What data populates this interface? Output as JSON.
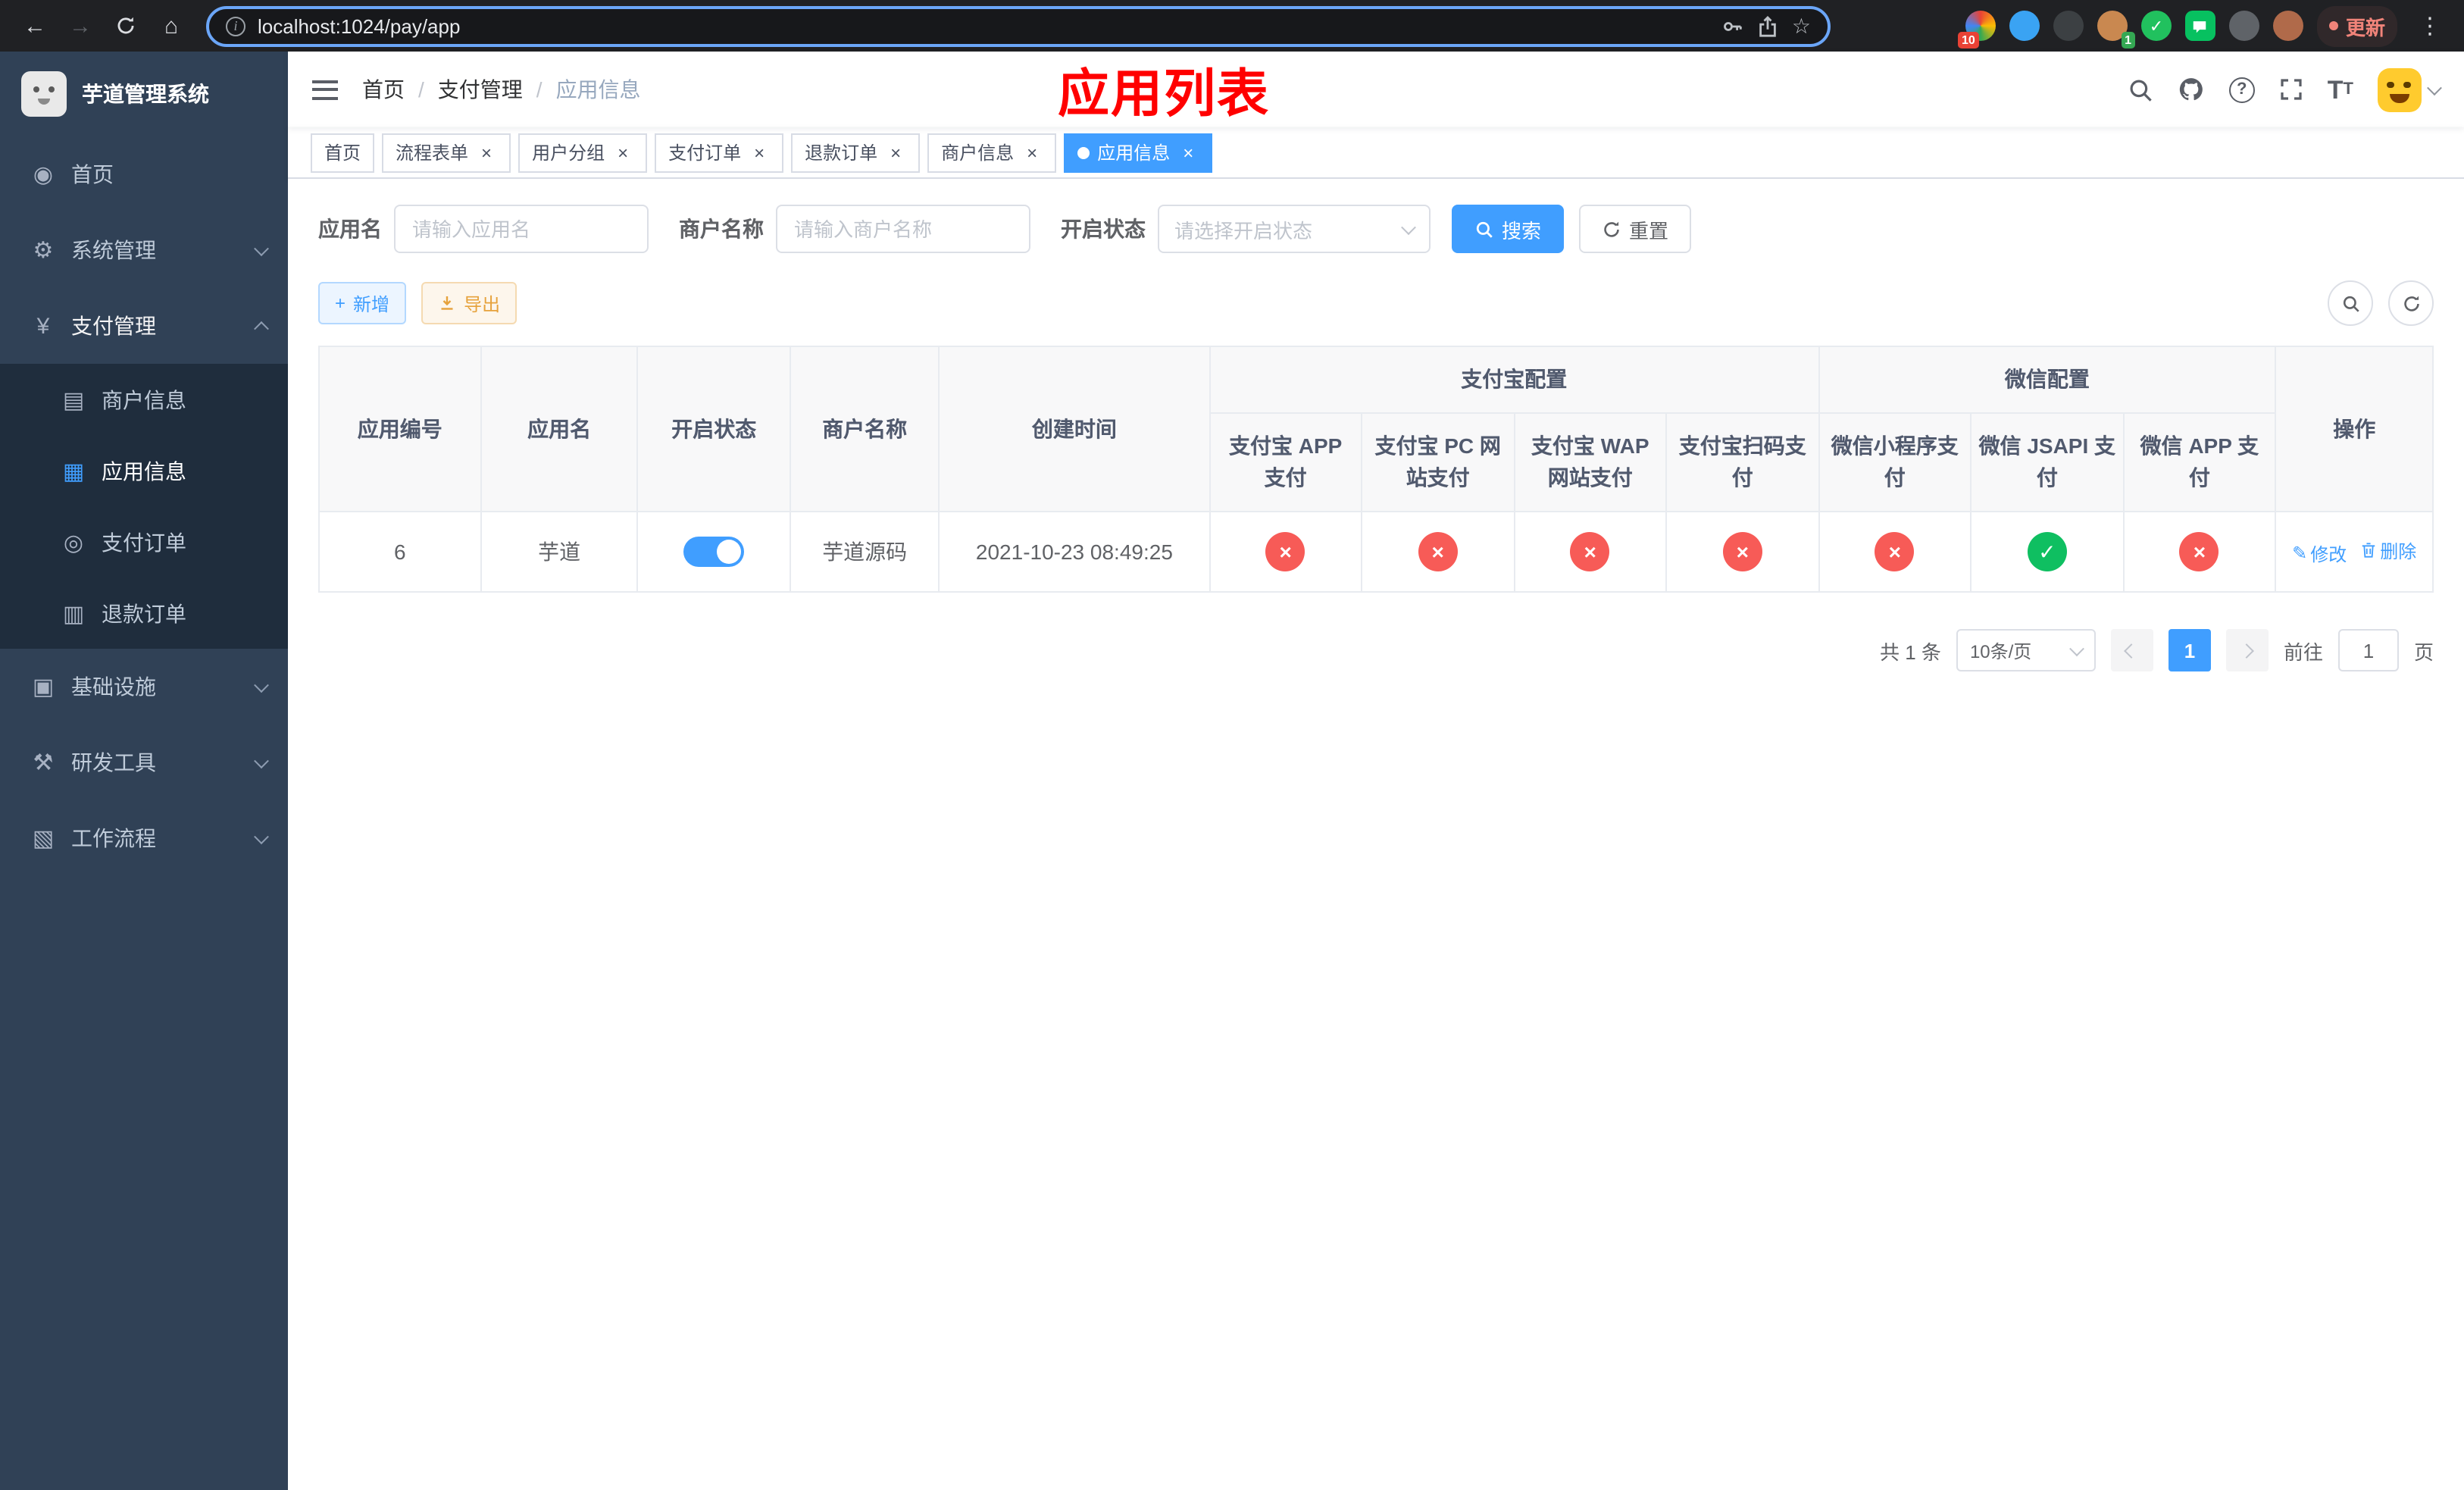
{
  "colors": {
    "accent_blue": "#409eff",
    "success_green": "#0fbf61",
    "danger_red": "#f75b57",
    "warning_orange": "#e6a23c",
    "banner_red": "#ff0000",
    "sidebar_bg": "#304156",
    "sidebar_submenu_bg": "#1f2d3d"
  },
  "browser": {
    "url": "localhost:1024/pay/app",
    "update_label": "更新",
    "extension_badge_1": "10",
    "extension_badge_2": "1"
  },
  "icons": {
    "back": "←",
    "forward": "→",
    "home": "⌂",
    "info": "i",
    "star": "☆",
    "ellipsis": "⋮",
    "check": "✓",
    "question": "?",
    "close": "×",
    "plus": "+",
    "edit": "✎",
    "dashboard": "◉",
    "gear": "⚙",
    "yen": "¥",
    "merchant_card": "▤",
    "app_grid": "▦",
    "pay_order": "◎",
    "refund_doc": "▥",
    "infra": "▣",
    "tools": "⚒",
    "workflow": "▧",
    "font_large": "T",
    "font_small": "T"
  },
  "sidebar": {
    "app_title": "芋道管理系统",
    "items": [
      {
        "label": "首页"
      },
      {
        "label": "系统管理"
      },
      {
        "label": "支付管理"
      },
      {
        "label": "基础设施"
      },
      {
        "label": "研发工具"
      },
      {
        "label": "工作流程"
      }
    ],
    "payment_children": [
      {
        "label": "商户信息"
      },
      {
        "label": "应用信息"
      },
      {
        "label": "支付订单"
      },
      {
        "label": "退款订单"
      }
    ]
  },
  "navbar": {
    "breadcrumb": [
      {
        "label": "首页"
      },
      {
        "label": "支付管理"
      },
      {
        "label": "应用信息"
      }
    ],
    "banner": "应用列表"
  },
  "tabs": [
    {
      "label": "首页"
    },
    {
      "label": "流程表单"
    },
    {
      "label": "用户分组"
    },
    {
      "label": "支付订单"
    },
    {
      "label": "退款订单"
    },
    {
      "label": "商户信息"
    },
    {
      "label": "应用信息"
    }
  ],
  "filters": {
    "app_name_label": "应用名",
    "app_name_placeholder": "请输入应用名",
    "merchant_label": "商户名称",
    "merchant_placeholder": "请输入商户名称",
    "status_label": "开启状态",
    "status_placeholder": "请选择开启状态",
    "search_button": "搜索",
    "reset_button": "重置"
  },
  "toolbar": {
    "add_button": "新增",
    "export_button": "导出"
  },
  "table": {
    "headers": {
      "app_id": "应用编号",
      "app_name": "应用名",
      "status": "开启状态",
      "merchant_name": "商户名称",
      "create_time": "创建时间",
      "alipay_group": "支付宝配置",
      "wechat_group": "微信配置",
      "alipay_app": "支付宝 APP 支付",
      "alipay_pc": "支付宝 PC 网站支付",
      "alipay_wap": "支付宝 WAP 网站支付",
      "alipay_qr": "支付宝扫码支付",
      "wechat_lite": "微信小程序支付",
      "wechat_jsapi": "微信 JSAPI 支付",
      "wechat_app": "微信 APP 支付",
      "actions": "操作"
    },
    "rows": [
      {
        "app_id": "6",
        "app_name": "芋道",
        "status": "on",
        "merchant_name": "芋道源码",
        "create_time": "2021-10-23 08:49:25",
        "alipay_app": "fail",
        "alipay_pc": "fail",
        "alipay_wap": "fail",
        "alipay_qr": "fail",
        "wechat_lite": "fail",
        "wechat_jsapi": "success",
        "wechat_app": "fail",
        "edit_label": "修改",
        "delete_label": "删除"
      }
    ]
  },
  "pagination": {
    "total_text": "共 1 条",
    "page_size": "10条/页",
    "current_page": "1",
    "goto_label": "前往",
    "goto_value": "1",
    "goto_unit": "页"
  }
}
